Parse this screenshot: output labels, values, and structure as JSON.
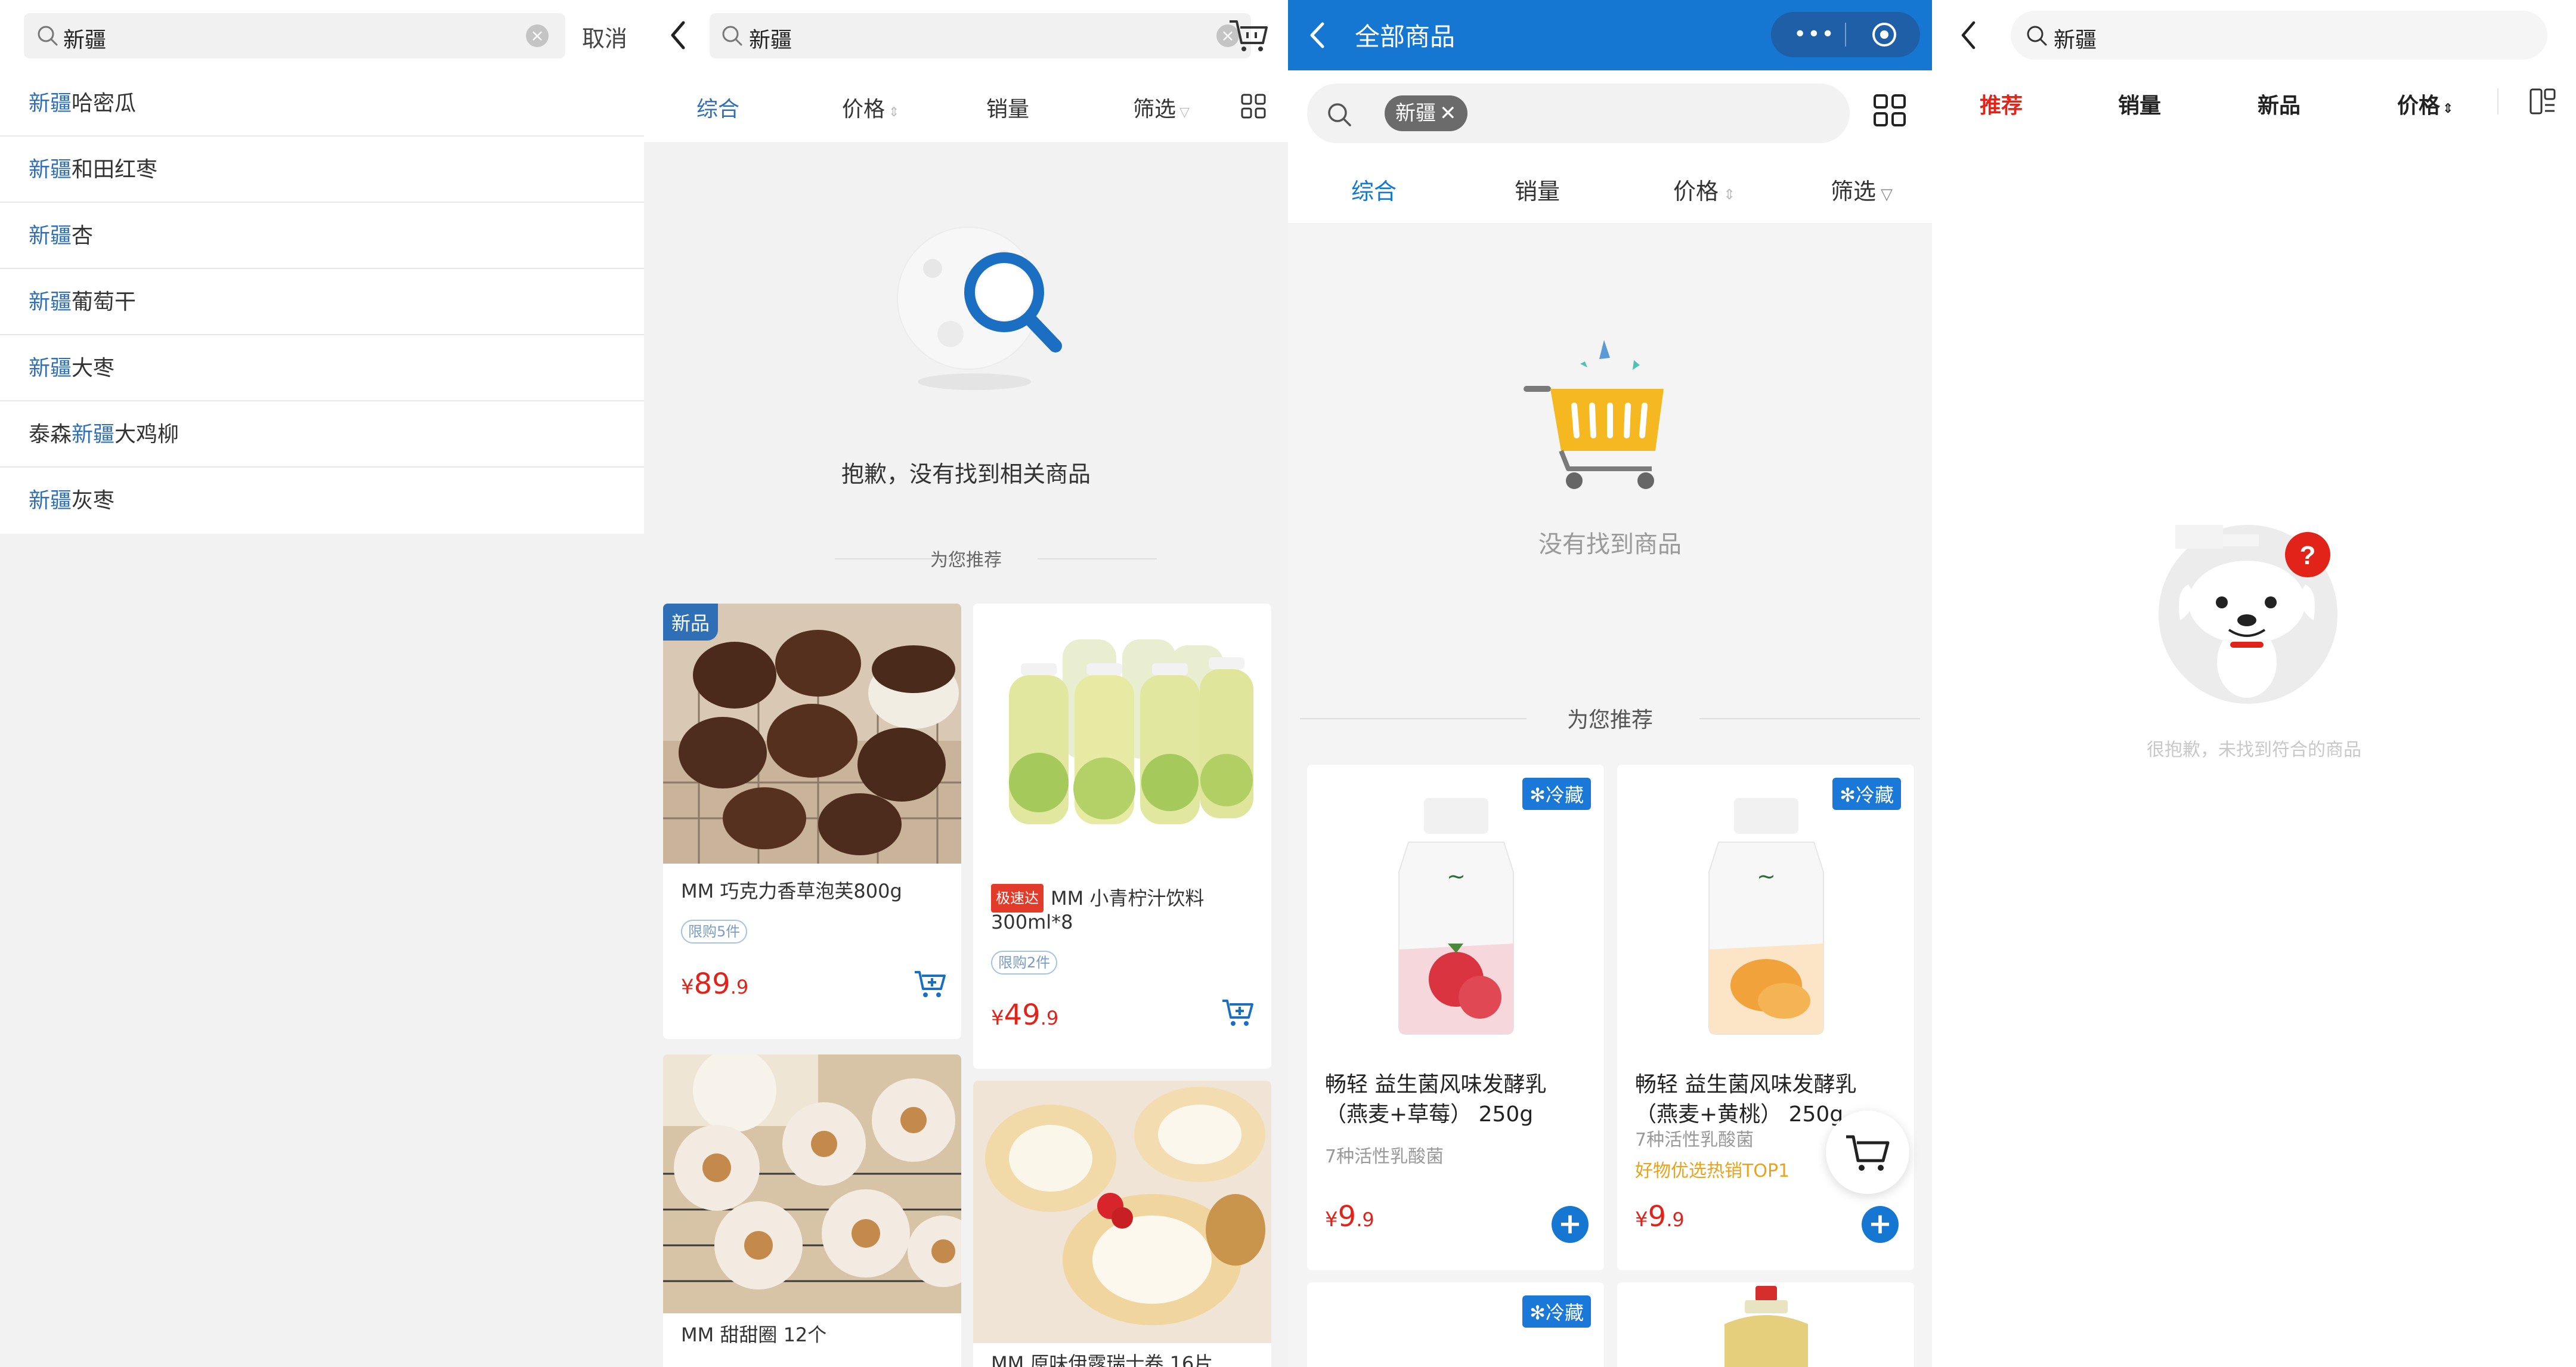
{
  "panel1": {
    "search": {
      "query": "新疆",
      "cancel_label": "取消"
    },
    "suggestions": [
      {
        "prefix": "",
        "highlight": "新疆",
        "suffix": "哈密瓜"
      },
      {
        "prefix": "",
        "highlight": "新疆",
        "suffix": "和田红枣"
      },
      {
        "prefix": "",
        "highlight": "新疆",
        "suffix": "杏"
      },
      {
        "prefix": "",
        "highlight": "新疆",
        "suffix": "葡萄干"
      },
      {
        "prefix": "",
        "highlight": "新疆",
        "suffix": "大枣"
      },
      {
        "prefix": "泰森",
        "highlight": "新疆",
        "suffix": "大鸡柳"
      },
      {
        "prefix": "",
        "highlight": "新疆",
        "suffix": "灰枣"
      }
    ],
    "highlight_color": "#2f6fb5"
  },
  "panel2": {
    "search": {
      "query": "新疆"
    },
    "tabs": [
      {
        "label": "综合"
      },
      {
        "label": "价格"
      },
      {
        "label": "销量"
      },
      {
        "label": "筛选"
      }
    ],
    "empty_message": "抱歉，没有找到相关商品",
    "recommend_label": "为您推荐",
    "products": [
      {
        "badge": "新品",
        "name": "MM 巧克力香草泡芙800g",
        "limit": "限购5件",
        "currency": "¥",
        "price_int": "89",
        "price_dec": ".9"
      },
      {
        "tag": "极速达",
        "name": "MM 小青柠汁饮料",
        "name2": "300ml*8",
        "limit": "限购2件",
        "currency": "¥",
        "price_int": "49",
        "price_dec": ".9"
      },
      {
        "name": "MM 甜甜圈 12个"
      },
      {
        "name": "MM 原味伊露瑞士卷 16片"
      }
    ],
    "accent_color": "#2f6fb5",
    "price_color": "#e2231a"
  },
  "panel3": {
    "header_title": "全部商品",
    "search_chip": "新疆",
    "tabs": [
      {
        "label": "综合"
      },
      {
        "label": "销量"
      },
      {
        "label": "价格"
      },
      {
        "label": "筛选"
      }
    ],
    "empty_message": "没有找到商品",
    "recommend_label": "为您推荐",
    "products": [
      {
        "badge": "✻冷藏",
        "name": "畅轻 益生菌风味发酵乳",
        "name2": "（燕麦+草莓） 250g",
        "sub1": "7种活性乳酸菌",
        "currency": "¥",
        "price_int": "9",
        "price_dec": ".9"
      },
      {
        "badge": "✻冷藏",
        "name": "畅轻 益生菌风味发酵乳",
        "name2": "（燕麦+黄桃） 250g",
        "sub1": "7种活性乳酸菌",
        "sub2": "好物优选热销TOP1",
        "currency": "¥",
        "price_int": "9",
        "price_dec": ".9"
      },
      {
        "badge": "✻冷藏"
      },
      {}
    ],
    "header_color": "#1677d2"
  },
  "panel4": {
    "search": {
      "query": "新疆"
    },
    "tabs": [
      {
        "label": "推荐"
      },
      {
        "label": "销量"
      },
      {
        "label": "新品"
      },
      {
        "label": "价格"
      }
    ],
    "empty_message": "很抱歉，未找到符合的商品",
    "accent_color": "#e2231a"
  }
}
